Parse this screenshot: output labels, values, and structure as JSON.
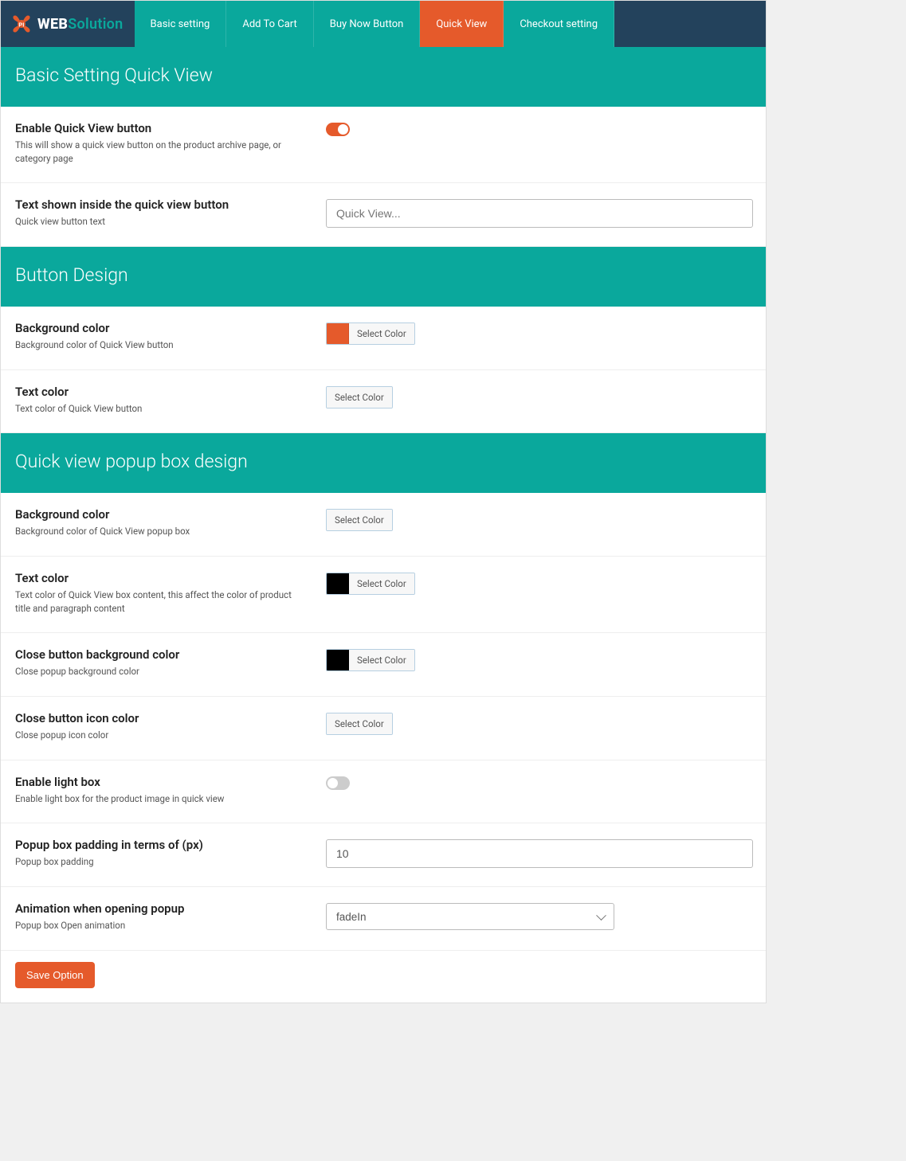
{
  "brand": {
    "pi": "PI",
    "web": "WEB",
    "solution": "Solution"
  },
  "tabs": [
    {
      "label": "Basic setting"
    },
    {
      "label": "Add To Cart"
    },
    {
      "label": "Buy Now Button"
    },
    {
      "label": "Quick View"
    },
    {
      "label": "Checkout setting"
    }
  ],
  "active_tab_index": 3,
  "colors": {
    "orange": "#e55a2b",
    "white": "#ffffff",
    "black": "#000000"
  },
  "select_color_label": "Select Color",
  "sections": {
    "basic": {
      "header": "Basic Setting Quick View",
      "enable": {
        "title": "Enable Quick View button",
        "desc": "This will show a quick view button on the product archive page, or category page",
        "value": true
      },
      "text_inside": {
        "title": "Text shown inside the quick view button",
        "desc": "Quick view button text",
        "placeholder": "Quick View..."
      }
    },
    "button_design": {
      "header": "Button Design",
      "bg": {
        "title": "Background color",
        "desc": "Background color of Quick View button",
        "color": "#e55a2b"
      },
      "text": {
        "title": "Text color",
        "desc": "Text color of Quick View button",
        "color": "#ffffff"
      }
    },
    "popup": {
      "header": "Quick view popup box design",
      "bg": {
        "title": "Background color",
        "desc": "Background color of Quick View popup box",
        "color": "#ffffff"
      },
      "text": {
        "title": "Text color",
        "desc": "Text color of Quick View box content, this affect the color of product title and paragraph content",
        "color": "#000000"
      },
      "close_bg": {
        "title": "Close button background color",
        "desc": "Close popup background color",
        "color": "#000000"
      },
      "close_icon": {
        "title": "Close button icon color",
        "desc": "Close popup icon color",
        "color": "#ffffff"
      },
      "lightbox": {
        "title": "Enable light box",
        "desc": "Enable light box for the product image in quick view",
        "value": false
      },
      "padding": {
        "title": "Popup box padding in terms of (px)",
        "desc": "Popup box padding",
        "value": "10"
      },
      "animation": {
        "title": "Animation when opening popup",
        "desc": "Popup box Open animation",
        "value": "fadeIn"
      }
    }
  },
  "save_label": "Save Option"
}
